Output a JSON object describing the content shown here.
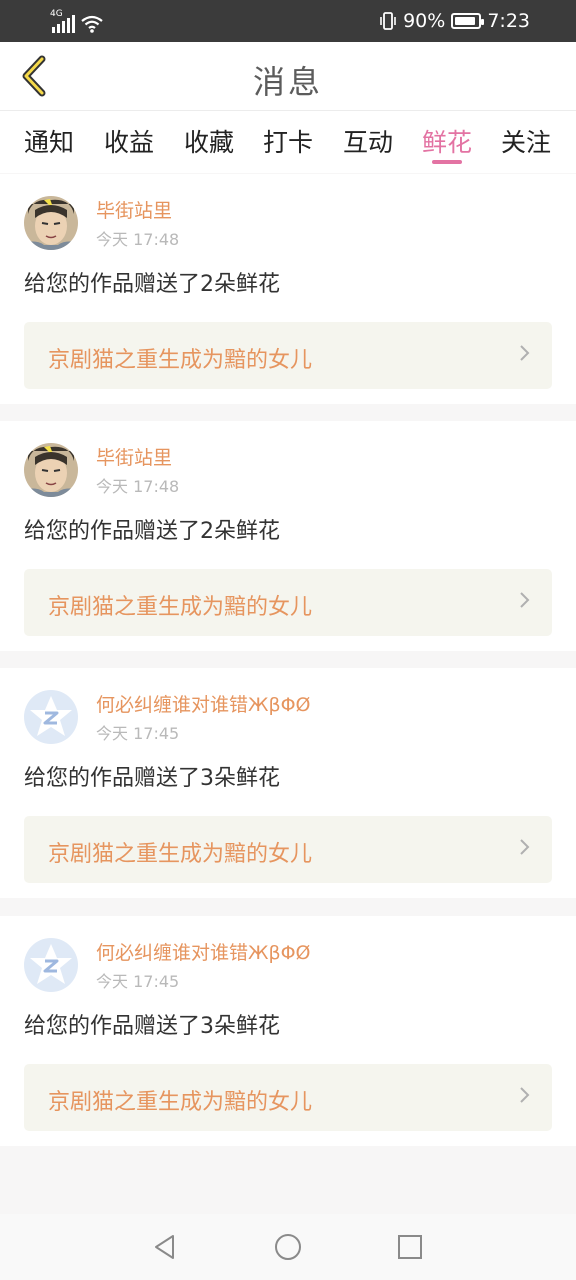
{
  "status_bar": {
    "network_label": "4G",
    "battery_percent": "90%",
    "battery_level": 0.9,
    "time": "7:23",
    "icons": [
      "signal-icon",
      "wifi-icon",
      "vibrate-icon",
      "battery-icon"
    ]
  },
  "header": {
    "title": "消息",
    "back_icon": "chevron-left-icon"
  },
  "tabs": [
    {
      "label": "通知"
    },
    {
      "label": "收益"
    },
    {
      "label": "收藏"
    },
    {
      "label": "打卡"
    },
    {
      "label": "互动"
    },
    {
      "label": "鲜花",
      "active": true
    },
    {
      "label": "关注"
    }
  ],
  "messages": [
    {
      "username": "毕街站里",
      "time": "今天 17:48",
      "text": "给您的作品赠送了2朵鲜花",
      "work_title": "京剧猫之重生成为黯的女儿",
      "avatar": "anime-avatar"
    },
    {
      "username": "毕街站里",
      "time": "今天 17:48",
      "text": "给您的作品赠送了2朵鲜花",
      "work_title": "京剧猫之重生成为黯的女儿",
      "avatar": "anime-avatar"
    },
    {
      "username": "何必纠缠谁对谁错ЖβΦØ",
      "time": "今天 17:45",
      "text": "给您的作品赠送了3朵鲜花",
      "work_title": "京剧猫之重生成为黯的女儿",
      "avatar": "qq-avatar"
    },
    {
      "username": "何必纠缠谁对谁错ЖβΦØ",
      "time": "今天 17:45",
      "text": "给您的作品赠送了3朵鲜花",
      "work_title": "京剧猫之重生成为黯的女儿",
      "avatar": "qq-avatar"
    }
  ],
  "colors": {
    "accent": "#e373a3",
    "username": "#e6955f",
    "link_bg": "#f5f5ee"
  }
}
